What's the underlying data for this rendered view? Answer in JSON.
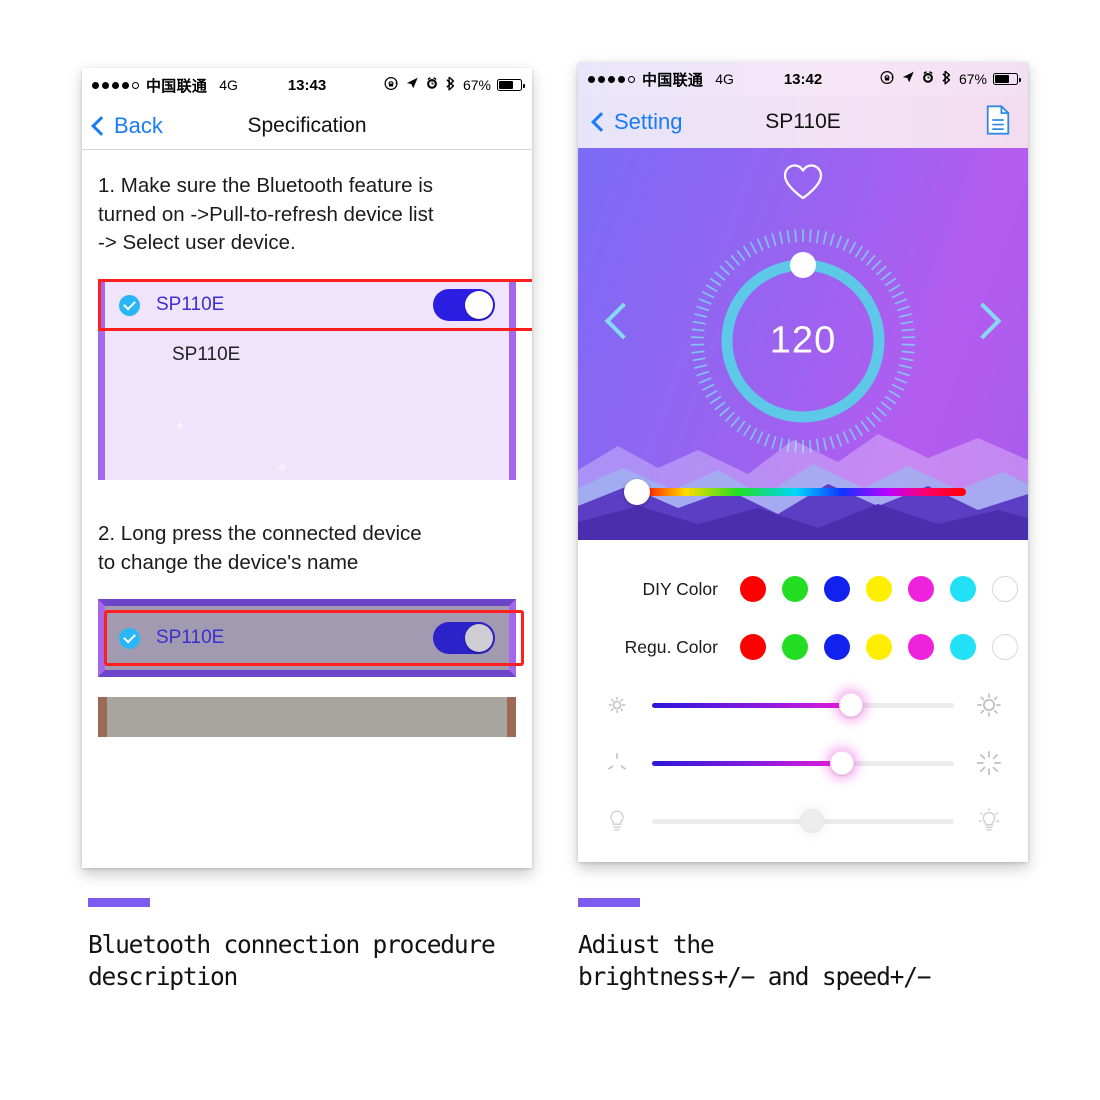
{
  "left_phone": {
    "status_bar": {
      "signal_dots_filled": 4,
      "signal_dots_total": 5,
      "carrier": "中国联通",
      "network": "4G",
      "time": "13:43",
      "battery_percent": "67%",
      "icons": [
        "rotation-lock-icon",
        "location-arrow-icon",
        "alarm-clock-icon",
        "bluetooth-icon",
        "battery-icon"
      ]
    },
    "nav": {
      "back_label": "Back",
      "title": "Specification"
    },
    "step1": {
      "text": "1. Make sure the Bluetooth feature is\nturned on ->Pull-to-refresh device list\n-> Select user device."
    },
    "step1_panel": {
      "row1_device": "SP110E",
      "row2_device": "SP110E",
      "toggle_on": true,
      "highlight_color": "#ff1f1f"
    },
    "step2": {
      "text": "2. Long press the connected device\nto change the device's name"
    },
    "step2_panel": {
      "row1_device": "SP110E",
      "toggle_on": true
    }
  },
  "right_phone": {
    "status_bar": {
      "signal_dots_filled": 4,
      "signal_dots_total": 5,
      "carrier": "中国联通",
      "network": "4G",
      "time": "13:42",
      "battery_percent": "67%",
      "icons": [
        "rotation-lock-icon",
        "location-arrow-icon",
        "alarm-clock-icon",
        "bluetooth-icon",
        "battery-icon"
      ]
    },
    "nav": {
      "back_label": "Setting",
      "title": "SP110E",
      "right_icon": "document-icon"
    },
    "hero": {
      "favorite_icon": "heart-outline-icon",
      "prev_icon": "chevron-left-icon",
      "next_icon": "chevron-right-icon",
      "dial_value": "120",
      "dial_knob_angle_deg": 0,
      "ring_color": "#5ec8e8",
      "hue_slider_position_percent": 0
    },
    "diy_color": {
      "label": "DIY Color",
      "swatches": [
        "#ff0000",
        "#22dd22",
        "#1122ee",
        "#ffee00",
        "#ee22dd",
        "#22e0f5",
        "#ffffff"
      ]
    },
    "regu_color": {
      "label": "Regu. Color",
      "swatches": [
        "#ff0000",
        "#22dd22",
        "#1122ee",
        "#ffee00",
        "#ee22dd",
        "#22e0f5",
        "#ffffff"
      ]
    },
    "sliders": [
      {
        "name": "brightness",
        "left_icon": "brightness-low-icon",
        "right_icon": "brightness-high-icon",
        "value_percent": 66,
        "enabled": true
      },
      {
        "name": "speed",
        "left_icon": "speed-low-icon",
        "right_icon": "speed-high-icon",
        "value_percent": 63,
        "enabled": true
      },
      {
        "name": "warmth",
        "left_icon": "bulb-off-icon",
        "right_icon": "bulb-on-icon",
        "value_percent": 53,
        "enabled": false
      }
    ]
  },
  "captions": {
    "left": "Bluetooth connection procedure\ndescription",
    "right": "Adiust the\nbrightness+/− and speed+/−",
    "accent_color": "#7c5cf0"
  }
}
